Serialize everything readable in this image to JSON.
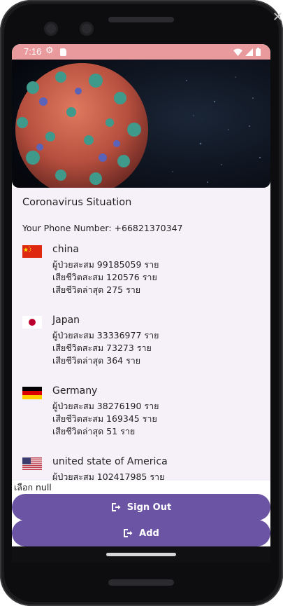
{
  "status": {
    "time": "7:16"
  },
  "app": {
    "heading": "Coronavirus Situation",
    "phone_label": "Your Phone Number: +66821370347",
    "countries": [
      {
        "name": "china",
        "cases": "ผู้ป่วยสะสม 99185059 ราย",
        "deaths_total": "เสียชีวิตสะสม 120576 ราย",
        "deaths_recent": "เสียชีวิตล่าสุด 275 ราย"
      },
      {
        "name": "Japan",
        "cases": "ผู้ป่วยสะสม 33336977 ราย",
        "deaths_total": "เสียชีวิตสะสม 73273 ราย",
        "deaths_recent": "เสียชีวิตล่าสุด 364 ราย"
      },
      {
        "name": "Germany",
        "cases": "ผู้ป่วยสะสม 38276190 ราย",
        "deaths_total": "เสียชีวิตสะสม 169345 ราย",
        "deaths_recent": "เสียชีวิตล่าสุด 51 ราย"
      },
      {
        "name": "united state of America",
        "cases": "ผู้ป่วยสะสม 102417985 ราย"
      }
    ],
    "selected_label": "เลือก null",
    "buttons": {
      "sign_out": "Sign Out",
      "add": "Add"
    }
  },
  "colors": {
    "status_bar": "#e99a9c",
    "button": "#6b54a4",
    "content_bg": "#f6f1f8"
  },
  "icons": [
    "settings-icon",
    "sd-card-icon",
    "wifi-icon",
    "signal-icon",
    "battery-icon",
    "logout-icon"
  ]
}
